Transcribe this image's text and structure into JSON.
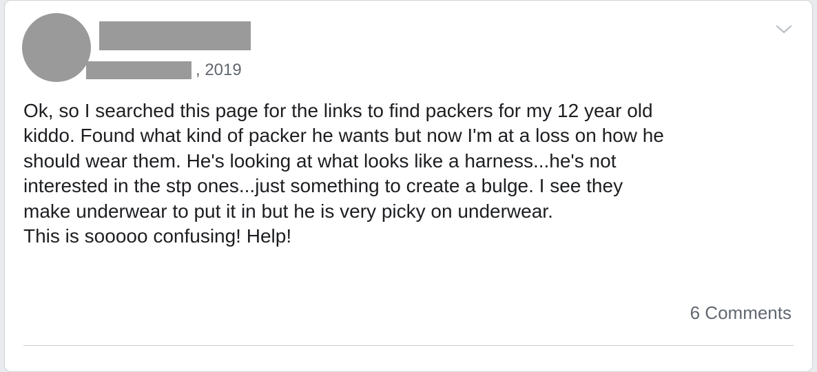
{
  "post": {
    "date_suffix": ", 2019",
    "text_lines": [
      "Ok, so I searched this page for the links to find packers for my 12 year old",
      "kiddo. Found what kind of packer he wants but now I'm at a loss on how he",
      "should wear them. He's looking at what looks like a harness...he's not",
      "interested in the stp ones...just something to create a bulge. I see they",
      "make underwear to put it in but he is very picky on underwear.",
      "This is sooooo confusing! Help!"
    ],
    "comments_label": "6 Comments",
    "menu_icon": "chevron-down-icon"
  },
  "colors": {
    "redaction": "#9a9a9a",
    "card_bg": "#ffffff",
    "text": "#1c1e21",
    "secondary_text": "#616770"
  }
}
